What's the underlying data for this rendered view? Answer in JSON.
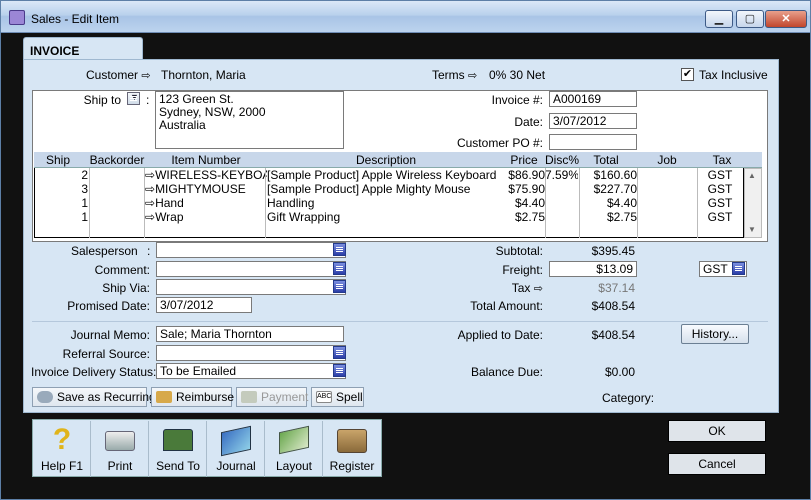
{
  "window": {
    "title": "Sales - Edit Item",
    "min": "▁",
    "max": "▢",
    "close": "✕"
  },
  "tab": {
    "label": "INVOICE"
  },
  "header": {
    "customer_label": "Customer",
    "customer_value": "Thornton, Maria",
    "terms_label": "Terms",
    "terms_value": "0% 30 Net",
    "tax_inclusive_label": "Tax Inclusive",
    "tax_inclusive_checked": true
  },
  "ship": {
    "label": "Ship to",
    "address": [
      "123 Green St.",
      "Sydney, NSW, 2000",
      "Australia"
    ]
  },
  "invoice": {
    "number_label": "Invoice #:",
    "number": "A000169",
    "date_label": "Date:",
    "date": "3/07/2012",
    "po_label": "Customer PO #:",
    "po": ""
  },
  "table": {
    "headers": [
      "Ship",
      "Backorder",
      "Item Number",
      "Description",
      "Price",
      "Disc%",
      "Total",
      "Job",
      "Tax"
    ],
    "rows": [
      {
        "ship": "2",
        "backorder": "",
        "item": "WIRELESS-KEYBOAR",
        "description": "[Sample Product] Apple Wireless Keyboard",
        "price": "$86.90",
        "disc": "7.59%",
        "total": "$160.60",
        "job": "",
        "tax": "GST"
      },
      {
        "ship": "3",
        "backorder": "",
        "item": "MIGHTYMOUSE",
        "description": "[Sample Product] Apple Mighty Mouse",
        "price": "$75.90",
        "disc": "",
        "total": "$227.70",
        "job": "",
        "tax": "GST"
      },
      {
        "ship": "1",
        "backorder": "",
        "item": "Hand",
        "description": "Handling",
        "price": "$4.40",
        "disc": "",
        "total": "$4.40",
        "job": "",
        "tax": "GST"
      },
      {
        "ship": "1",
        "backorder": "",
        "item": "Wrap",
        "description": "Gift Wrapping",
        "price": "$2.75",
        "disc": "",
        "total": "$2.75",
        "job": "",
        "tax": "GST"
      }
    ]
  },
  "details": {
    "salesperson_label": "Salesperson",
    "salesperson_colon": ":",
    "comment_label": "Comment:",
    "shipvia_label": "Ship Via:",
    "promised_label": "Promised Date:",
    "promised": "3/07/2012"
  },
  "totals": {
    "subtotal_label": "Subtotal:",
    "subtotal": "$395.45",
    "freight_label": "Freight:",
    "freight": "$13.09",
    "freight_tax": "GST",
    "tax_label": "Tax",
    "tax": "$37.14",
    "total_label": "Total Amount:",
    "total": "$408.54"
  },
  "lower": {
    "memo_label": "Journal Memo:",
    "memo": "Sale; Maria Thornton",
    "referral_label": "Referral Source:",
    "referral": "",
    "delivery_label": "Invoice Delivery Status:",
    "delivery": "To be Emailed",
    "applied_label": "Applied to Date:",
    "applied": "$408.54",
    "history_button": "History...",
    "balance_label": "Balance Due:",
    "balance": "$0.00"
  },
  "actions": {
    "save_recurring": "Save as Recurring",
    "reimburse": "Reimburse",
    "payment": "Payment",
    "spell": "Spell",
    "category_label": "Category:"
  },
  "toolbar": {
    "help": "Help F1",
    "print": "Print",
    "sendto": "Send To",
    "journal": "Journal",
    "layout": "Layout",
    "register": "Register"
  },
  "buttons": {
    "ok": "OK",
    "cancel": "Cancel"
  }
}
